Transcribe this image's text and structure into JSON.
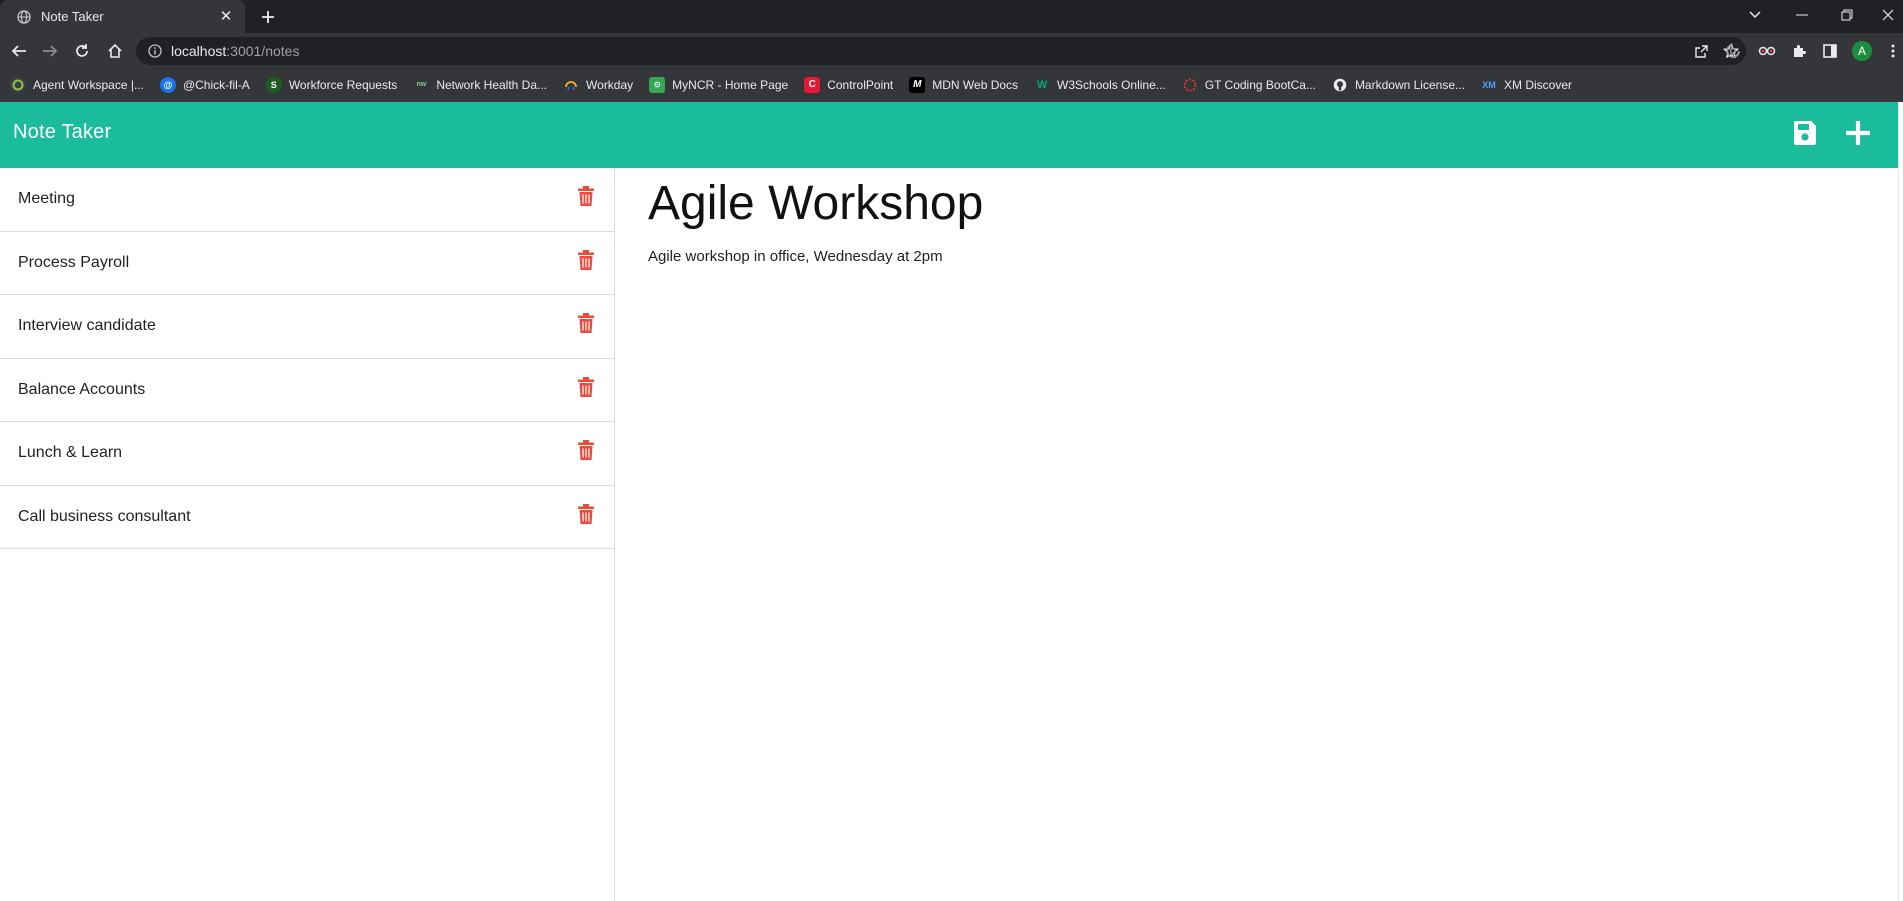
{
  "browser": {
    "tab_title": "Note Taker",
    "url_host": "localhost",
    "url_path": ":3001/notes",
    "profile_initial": "A",
    "bookmarks": [
      {
        "label": "Agent Workspace |...",
        "icon": "agent-icon",
        "color": "#4caf50"
      },
      {
        "label": "@Chick-fil-A",
        "icon": "at-icon",
        "color": "#1a73e8"
      },
      {
        "label": "Workforce Requests",
        "icon": "servicenow-icon",
        "color": "#2e7d32"
      },
      {
        "label": "Network Health Da...",
        "icon": "network-icon",
        "color": "#81c995"
      },
      {
        "label": "Workday",
        "icon": "workday-icon",
        "color": "#f5a623"
      },
      {
        "label": "MyNCR - Home Page",
        "icon": "ncr-icon",
        "color": "#34a853"
      },
      {
        "label": "ControlPoint",
        "icon": "chickfila-icon",
        "color": "#e51937"
      },
      {
        "label": "MDN Web Docs",
        "icon": "mdn-icon",
        "color": "#000000"
      },
      {
        "label": "W3Schools Online...",
        "icon": "w3schools-icon",
        "color": "#04aa6d"
      },
      {
        "label": "GT Coding BootCa...",
        "icon": "gt-icon",
        "color": "#e53935"
      },
      {
        "label": "Markdown License...",
        "icon": "github-icon",
        "color": "#ffffff"
      },
      {
        "label": "XM Discover",
        "icon": "xm-icon",
        "color": "#1a73e8"
      }
    ]
  },
  "app": {
    "title": "Note Taker",
    "accent": "#1abc9c",
    "delete_color": "#e74c3c"
  },
  "notes": [
    {
      "title": "Meeting"
    },
    {
      "title": "Process Payroll"
    },
    {
      "title": "Interview candidate"
    },
    {
      "title": "Balance Accounts"
    },
    {
      "title": "Lunch & Learn"
    },
    {
      "title": "Call business consultant"
    }
  ],
  "active_note": {
    "title": "Agile Workshop",
    "text": "Agile workshop in office, Wednesday at 2pm"
  }
}
